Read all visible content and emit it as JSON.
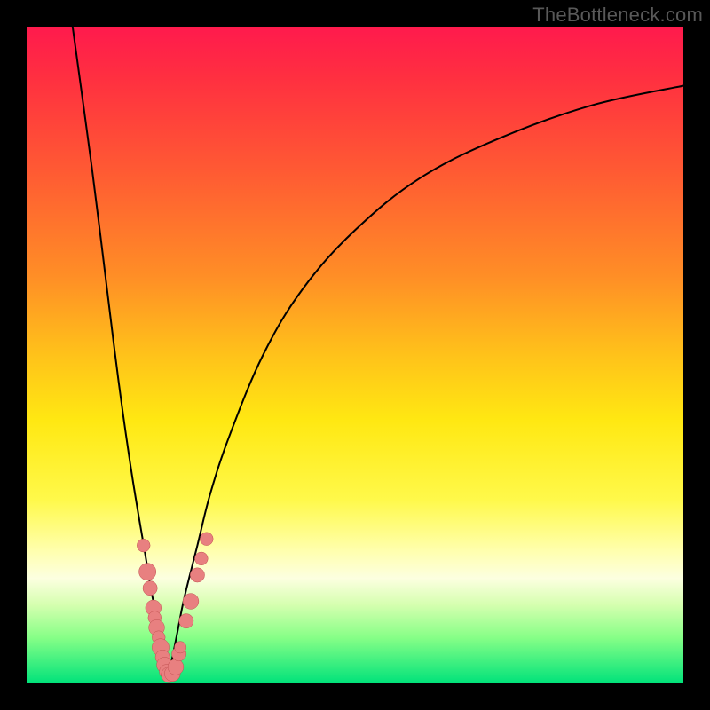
{
  "watermark": "TheBottleneck.com",
  "colors": {
    "frame": "#000000",
    "gradient_top": "#ff1a4d",
    "gradient_mid": "#ffe812",
    "gradient_bottom": "#00e27a",
    "curve": "#000000",
    "bead_fill": "#e88080",
    "bead_stroke": "#c05050"
  },
  "chart_data": {
    "type": "line",
    "title": "",
    "xlabel": "",
    "ylabel": "",
    "xlim": [
      0,
      100
    ],
    "ylim": [
      0,
      100
    ],
    "grid": false,
    "legend": false,
    "series": [
      {
        "name": "left-branch",
        "x": [
          7,
          10,
          12,
          14,
          16,
          18,
          19,
          20,
          20.5,
          21,
          21.5
        ],
        "y": [
          100,
          78,
          62,
          46,
          32,
          20,
          14,
          9,
          6,
          3,
          1
        ]
      },
      {
        "name": "right-branch",
        "x": [
          21.5,
          22,
          23,
          24,
          26,
          28,
          31,
          36,
          42,
          50,
          60,
          72,
          86,
          100
        ],
        "y": [
          1,
          3,
          8,
          13,
          21,
          29,
          38,
          50,
          60,
          69,
          77,
          83,
          88,
          91
        ]
      }
    ],
    "beads": {
      "name": "highlight-points",
      "points": [
        {
          "x": 17.8,
          "y": 21,
          "r": 1.0
        },
        {
          "x": 18.4,
          "y": 17,
          "r": 1.3
        },
        {
          "x": 18.8,
          "y": 14.5,
          "r": 1.1
        },
        {
          "x": 19.3,
          "y": 11.5,
          "r": 1.2
        },
        {
          "x": 19.5,
          "y": 10.0,
          "r": 1.0
        },
        {
          "x": 19.8,
          "y": 8.5,
          "r": 1.2
        },
        {
          "x": 20.1,
          "y": 7.0,
          "r": 1.0
        },
        {
          "x": 20.4,
          "y": 5.5,
          "r": 1.3
        },
        {
          "x": 20.7,
          "y": 4.0,
          "r": 1.1
        },
        {
          "x": 21.0,
          "y": 2.8,
          "r": 1.2
        },
        {
          "x": 21.3,
          "y": 1.8,
          "r": 1.1
        },
        {
          "x": 21.7,
          "y": 1.3,
          "r": 1.2
        },
        {
          "x": 22.2,
          "y": 1.5,
          "r": 1.2
        },
        {
          "x": 22.7,
          "y": 2.5,
          "r": 1.2
        },
        {
          "x": 23.2,
          "y": 4.5,
          "r": 1.1
        },
        {
          "x": 23.4,
          "y": 5.5,
          "r": 0.9
        },
        {
          "x": 24.3,
          "y": 9.5,
          "r": 1.1
        },
        {
          "x": 25.0,
          "y": 12.5,
          "r": 1.2
        },
        {
          "x": 26.0,
          "y": 16.5,
          "r": 1.1
        },
        {
          "x": 26.6,
          "y": 19.0,
          "r": 1.0
        },
        {
          "x": 27.4,
          "y": 22.0,
          "r": 1.0
        }
      ]
    }
  }
}
